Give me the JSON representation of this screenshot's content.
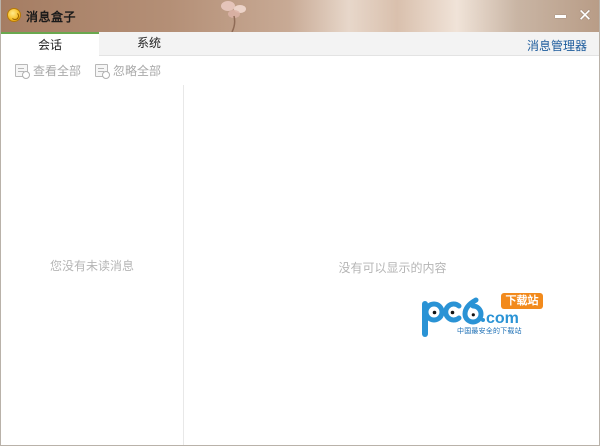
{
  "window": {
    "title": "消息盒子"
  },
  "tabs": [
    {
      "label": "会话",
      "active": true
    },
    {
      "label": "系统",
      "active": false
    }
  ],
  "header": {
    "manager_link": "消息管理器"
  },
  "toolbar": {
    "view_all": "查看全部",
    "ignore_all": "忽略全部"
  },
  "left_pane": {
    "empty_text": "您没有未读消息"
  },
  "right_pane": {
    "empty_text": "没有可以显示的内容"
  },
  "watermark": {
    "brand": "pc6.com",
    "badge": "下载站",
    "tagline": "中国最安全的下载站"
  },
  "colors": {
    "tab_accent": "#6aa84f",
    "link": "#1c5b9c",
    "muted_text": "#b5b5b5",
    "watermark_blue": "#1c6fb5",
    "watermark_orange": "#f28a1c"
  }
}
